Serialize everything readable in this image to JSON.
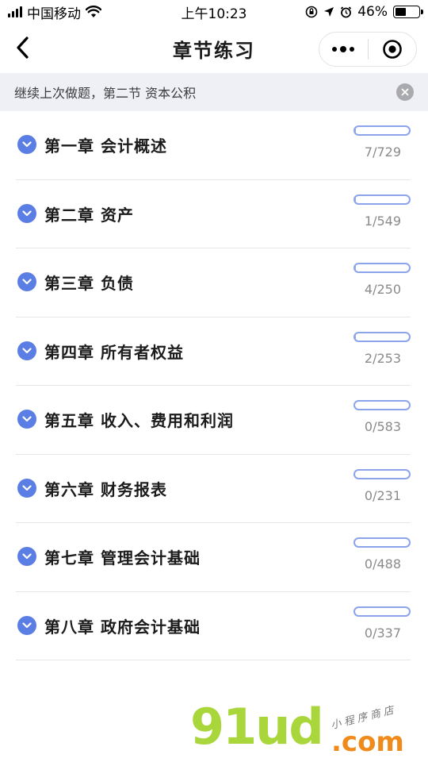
{
  "status_bar": {
    "carrier": "中国移动",
    "time": "上午10:23",
    "battery": "46%",
    "battery_level": 0.46
  },
  "nav": {
    "title": "章节练习",
    "back_icon": "chevron-left-icon",
    "more_icon": "more-dots-icon",
    "close_icon": "target-circle-icon"
  },
  "continue_bar": {
    "text": "继续上次做题，第二节 资本公积",
    "close_icon": "close-icon"
  },
  "chapters": [
    {
      "title": "第一章 会计概述",
      "count": "7/729",
      "progress": 0.0096
    },
    {
      "title": "第二章 资产",
      "count": "1/549",
      "progress": 0.0018
    },
    {
      "title": "第三章 负债",
      "count": "4/250",
      "progress": 0.016
    },
    {
      "title": "第四章 所有者权益",
      "count": "2/253",
      "progress": 0.0079
    },
    {
      "title": "第五章 收入、费用和利润",
      "count": "0/583",
      "progress": 0
    },
    {
      "title": "第六章 财务报表",
      "count": "0/231",
      "progress": 0
    },
    {
      "title": "第七章 管理会计基础",
      "count": "0/488",
      "progress": 0
    },
    {
      "title": "第八章 政府会计基础",
      "count": "0/337",
      "progress": 0
    }
  ],
  "watermark": {
    "logo": "91ud",
    "domain": ".com",
    "note": "小程序商店"
  },
  "colors": {
    "accent": "#5b7ee5",
    "progress": "#8ca4ea",
    "banner_bg": "#eef0f6"
  }
}
